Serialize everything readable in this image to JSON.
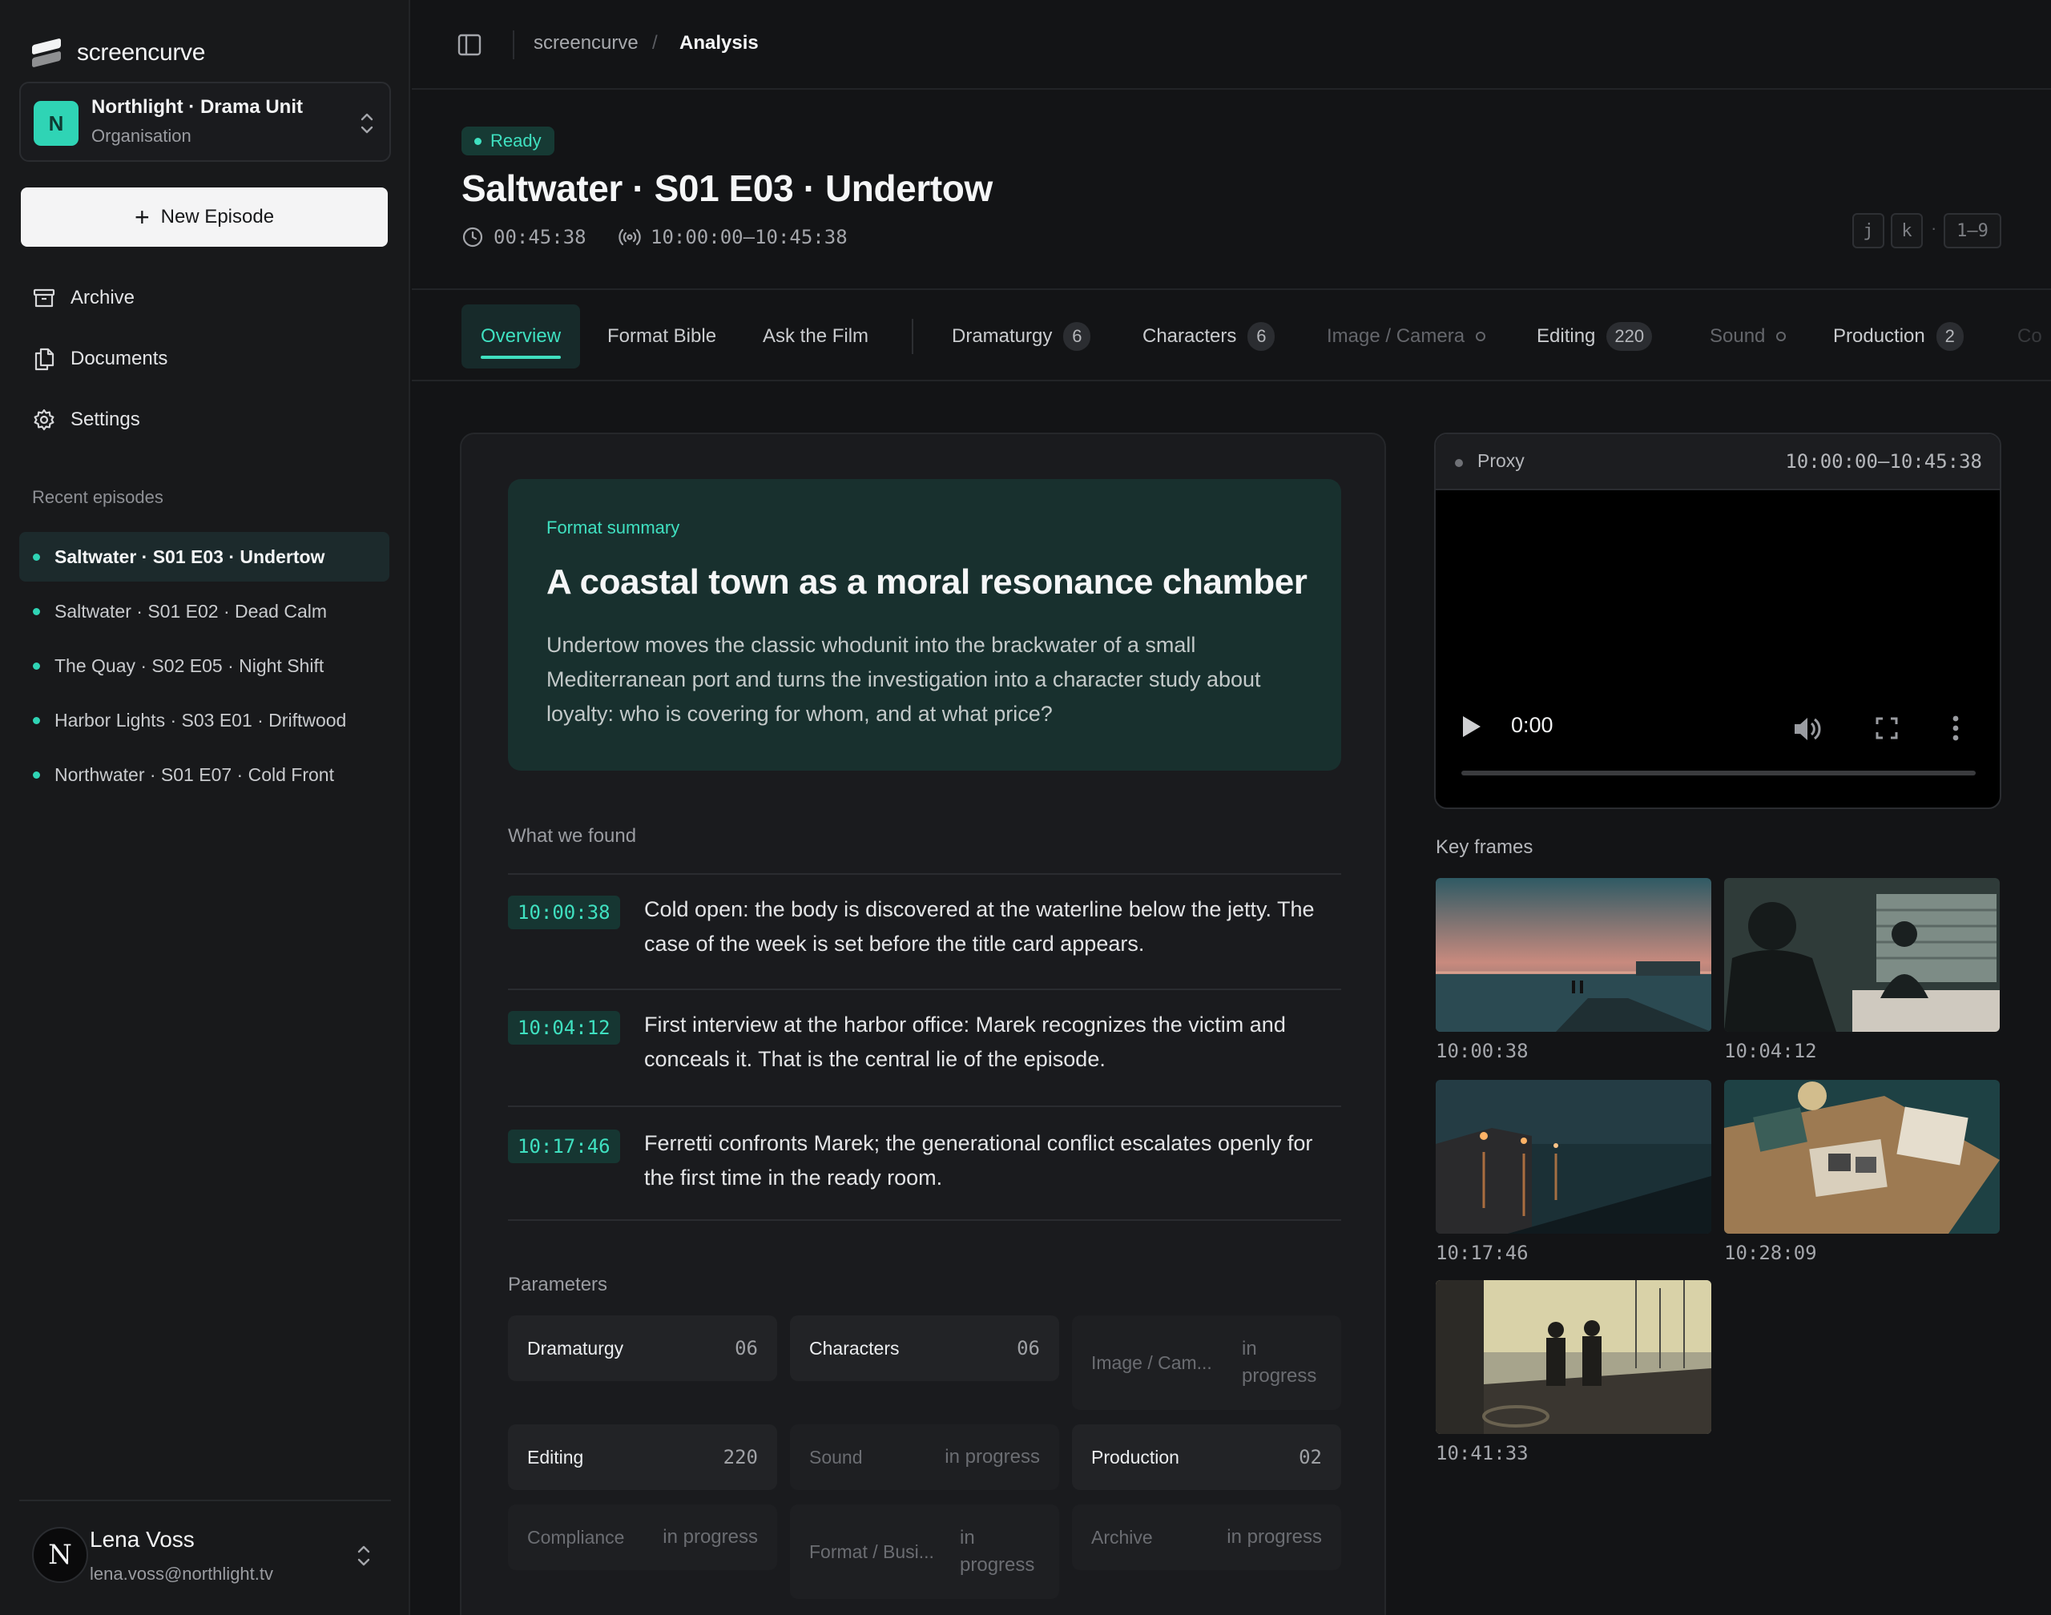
{
  "app": {
    "brand": "screencurve",
    "org": {
      "initial": "N",
      "name": "Northlight · Drama Unit",
      "type": "Organisation"
    },
    "new_episode_label": "New Episode",
    "nav": [
      {
        "label": "Archive",
        "icon": "archive-icon"
      },
      {
        "label": "Documents",
        "icon": "documents-icon"
      },
      {
        "label": "Settings",
        "icon": "gear-icon"
      }
    ],
    "recent_label": "Recent episodes",
    "recent": [
      "Saltwater · S01 E03 · Undertow",
      "Saltwater · S01 E02 · Dead Calm",
      "The Quay · S02 E05 · Night Shift",
      "Harbor Lights · S03 E01 · Driftwood",
      "Northwater · S01 E07 · Cold Front"
    ],
    "user": {
      "initial": "N",
      "name": "Lena Voss",
      "email": "lena.voss@northlight.tv"
    }
  },
  "breadcrumb": {
    "root": "screencurve",
    "sep": "/",
    "current": "Analysis"
  },
  "header": {
    "status": "Ready",
    "title": "Saltwater · S01 E03 · Undertow",
    "duration": "00:45:38",
    "timecode": "10:00:00–10:45:38",
    "shortcuts": [
      "j",
      "k",
      "·",
      "1–9"
    ]
  },
  "tabs": [
    {
      "label": "Overview",
      "active": true
    },
    {
      "label": "Format Bible"
    },
    {
      "label": "Ask the Film"
    },
    {
      "label": "Dramaturgy",
      "count": "6"
    },
    {
      "label": "Characters",
      "count": "6"
    },
    {
      "label": "Image / Camera",
      "pending": true
    },
    {
      "label": "Editing",
      "count": "220"
    },
    {
      "label": "Sound",
      "pending": true
    },
    {
      "label": "Production",
      "count": "2"
    },
    {
      "label": "Co"
    }
  ],
  "summary": {
    "label": "Format summary",
    "headline": "A coastal town as a moral resonance chamber",
    "body": "Undertow moves the classic whodunit into the brackwater of a small Mediterranean port and turns the investigation into a character study about loyalty: who is covering for whom, and at what price?"
  },
  "found": {
    "label": "What we found",
    "items": [
      {
        "tc": "10:00:38",
        "text": "Cold open: the body is discovered at the waterline below the jetty. The case of the week is set before the title card appears."
      },
      {
        "tc": "10:04:12",
        "text": "First interview at the harbor office: Marek recognizes the victim and conceals it. That is the central lie of the episode."
      },
      {
        "tc": "10:17:46",
        "text": "Ferretti confronts Marek; the generational conflict escalates openly for the first time in the ready room."
      }
    ]
  },
  "parameters": {
    "label": "Parameters",
    "items": [
      {
        "name": "Dramaturgy",
        "value": "06"
      },
      {
        "name": "Characters",
        "value": "06"
      },
      {
        "name": "Image / Cam...",
        "value": "in progress"
      },
      {
        "name": "Editing",
        "value": "220"
      },
      {
        "name": "Sound",
        "value": "in progress"
      },
      {
        "name": "Production",
        "value": "02"
      },
      {
        "name": "Compliance",
        "value": "in progress"
      },
      {
        "name": "Format / Busi...",
        "value": "in progress"
      },
      {
        "name": "Archive",
        "value": "in progress"
      }
    ]
  },
  "player": {
    "label": "Proxy",
    "timecode": "10:00:00–10:45:38",
    "time": "0:00",
    "progress": 0
  },
  "keyframes": {
    "label": "Key frames",
    "items": [
      "10:00:38",
      "10:04:12",
      "10:17:46",
      "10:28:09",
      "10:41:33"
    ]
  },
  "colors": {
    "accent": "#3fe0c0",
    "background": "#131416",
    "sidebar": "#18191b",
    "summary_bg": "#18302e"
  }
}
